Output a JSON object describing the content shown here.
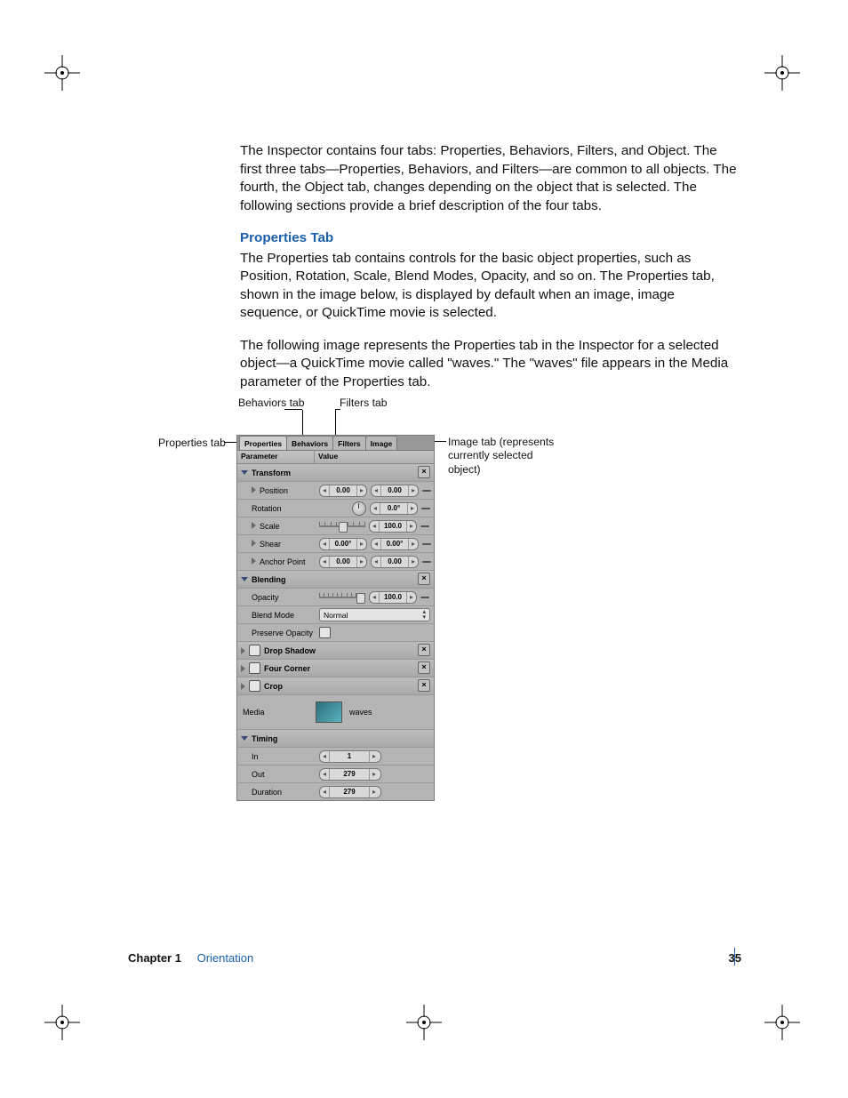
{
  "body": {
    "intro": "The Inspector contains four tabs:  Properties, Behaviors, Filters, and Object. The first three tabs—Properties, Behaviors, and Filters—are common to all objects. The fourth, the Object tab, changes depending on the object that is selected. The following sections provide a brief description of the four tabs.",
    "section_title": "Properties Tab",
    "para2": "The Properties tab contains controls for the basic object properties, such as Position, Rotation, Scale, Blend Modes, Opacity, and so on. The Properties tab, shown in the image below, is displayed by default when an image, image sequence, or QuickTime movie is selected.",
    "para3": "The following image represents the Properties tab in the Inspector for a selected object—a QuickTime movie called \"waves.\" The \"waves\" file appears in the Media parameter of the Properties tab."
  },
  "callouts": {
    "properties": "Properties tab",
    "behaviors": "Behaviors tab",
    "filters": "Filters tab",
    "image": "Image tab (represents currently selected object)"
  },
  "inspector": {
    "tabs": [
      "Properties",
      "Behaviors",
      "Filters",
      "Image"
    ],
    "header": {
      "param": "Parameter",
      "value": "Value"
    },
    "transform": {
      "label": "Transform",
      "position": {
        "label": "Position",
        "x": "0.00",
        "y": "0.00"
      },
      "rotation": {
        "label": "Rotation",
        "val": "0.0°"
      },
      "scale": {
        "label": "Scale",
        "val": "100.0"
      },
      "shear": {
        "label": "Shear",
        "x": "0.00°",
        "y": "0.00°"
      },
      "anchor": {
        "label": "Anchor Point",
        "x": "0.00",
        "y": "0.00"
      }
    },
    "blending": {
      "label": "Blending",
      "opacity": {
        "label": "Opacity",
        "val": "100.0"
      },
      "mode": {
        "label": "Blend Mode",
        "val": "Normal"
      },
      "preserve": {
        "label": "Preserve Opacity"
      }
    },
    "dropshadow": "Drop Shadow",
    "fourcorner": "Four Corner",
    "crop": "Crop",
    "media": {
      "label": "Media",
      "name": "waves"
    },
    "timing": {
      "label": "Timing",
      "in": {
        "label": "In",
        "val": "1"
      },
      "out": {
        "label": "Out",
        "val": "279"
      },
      "dur": {
        "label": "Duration",
        "val": "279"
      }
    }
  },
  "footer": {
    "chapter_label": "Chapter 1",
    "chapter_title": "Orientation",
    "page": "35"
  }
}
